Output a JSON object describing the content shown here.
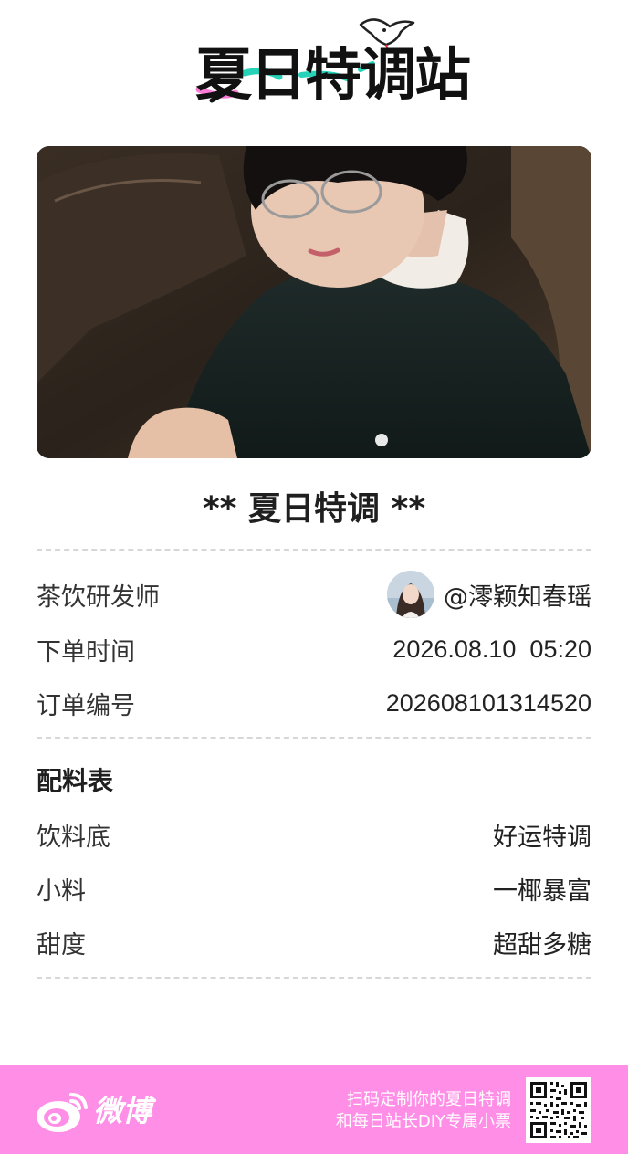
{
  "header": {
    "logo_text": "夏日特调站"
  },
  "receipt": {
    "title": "** 夏日特调 **",
    "rows": [
      {
        "label": "茶饮研发师",
        "value": "@澪颖知春瑶"
      },
      {
        "label": "下单时间",
        "value": "2026.08.10  05:20"
      },
      {
        "label": "订单编号",
        "value": "202608101314520"
      }
    ],
    "ingredients_title": "配料表",
    "ingredients": [
      {
        "label": "饮料底",
        "value": "好运特调"
      },
      {
        "label": "小料",
        "value": "一椰暴富"
      },
      {
        "label": "甜度",
        "value": "超甜多糖"
      }
    ]
  },
  "footer": {
    "brand": "微博",
    "line1": "扫码定制你的夏日特调",
    "line2": "和每日站长DIY专属小票",
    "background_color": "#ff8fe6"
  },
  "icons": {
    "logo_bird": "seagull-icon",
    "weibo": "weibo-eye-icon",
    "qr": "qr-code-icon"
  }
}
